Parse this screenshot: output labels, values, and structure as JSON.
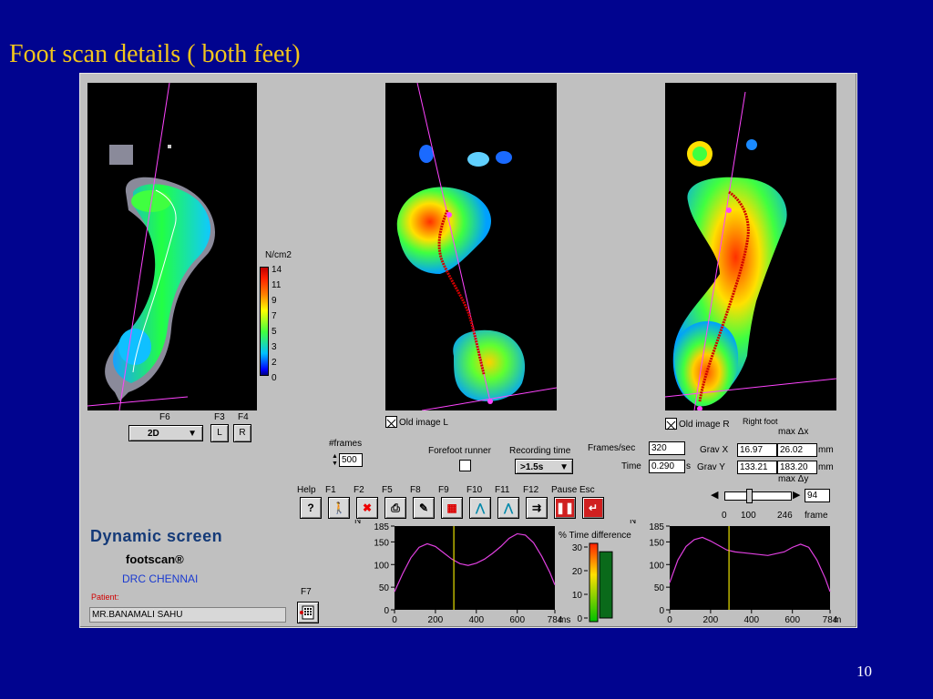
{
  "slide": {
    "title": "Foot scan details ( both feet)",
    "page_number": "10"
  },
  "colorbar": {
    "unit": "N/cm2",
    "ticks": [
      "14",
      "11",
      "9",
      "7",
      "5",
      "3",
      "2",
      "0"
    ]
  },
  "left_controls": {
    "f6_label": "F6",
    "f3_label": "F3",
    "f4_label": "F4",
    "mode_value": "2D",
    "l_button": "L",
    "r_button": "R"
  },
  "scans": {
    "old_image_l_label": "Old image L",
    "old_image_r_label": "Old image R",
    "right_foot_label": "Right foot"
  },
  "frames": {
    "label": "#frames",
    "value": "500"
  },
  "recording": {
    "forefoot_label": "Forefoot runner",
    "time_label": "Recording time",
    "time_value": ">1.5s"
  },
  "stats": {
    "fps_label": "Frames/sec",
    "fps_value": "320",
    "time_label": "Time",
    "time_value": "0.290",
    "time_unit": "s",
    "gravx_label": "Grav X",
    "gravx_value": "16.97",
    "max_dx_label": "max Δx",
    "max_dx_value": "26.02",
    "gravx_unit": "mm",
    "gravy_label": "Grav Y",
    "gravy_value": "133.21",
    "max_dy_label": "max Δy",
    "max_dy_value": "183.20",
    "gravy_unit": "mm"
  },
  "slider": {
    "value": "94",
    "ticks": [
      "0",
      "100",
      "246"
    ],
    "unit": "frame"
  },
  "toolbar": {
    "labels": [
      "Help",
      "F1",
      "F2",
      "F5",
      "F8",
      "F9",
      "F10",
      "F11",
      "F12",
      "Pause",
      "Esc"
    ],
    "f7_label": "F7"
  },
  "branding": {
    "app_name": "Dynamic screen",
    "product": "footscan®",
    "site": "DRC CHENNAI",
    "patient_label": "Patient:",
    "patient_name": "MR.BANAMALI SAHU"
  },
  "chart_data": [
    {
      "type": "line",
      "ylabel": "N",
      "xlabel": "ms",
      "ylim": [
        0,
        185
      ],
      "xlim": [
        0,
        784
      ],
      "yticks": [
        "185",
        "150",
        "100",
        "50",
        "0"
      ],
      "xticks": [
        "0",
        "200",
        "400",
        "600",
        "784"
      ],
      "cursor_x": 290,
      "series": [
        {
          "x": [
            0,
            40,
            80,
            120,
            160,
            200,
            240,
            280,
            320,
            360,
            400,
            440,
            480,
            520,
            560,
            600,
            640,
            680,
            720,
            760,
            784
          ],
          "y": [
            40,
            80,
            115,
            138,
            146,
            140,
            126,
            112,
            102,
            98,
            103,
            112,
            125,
            140,
            158,
            168,
            165,
            148,
            118,
            82,
            55
          ]
        }
      ]
    },
    {
      "type": "bar",
      "title": "% Time difference",
      "ylim": [
        0,
        30
      ],
      "yticks": [
        "30",
        "20",
        "10",
        "0"
      ],
      "series": [
        {
          "values": [
            28
          ]
        }
      ]
    },
    {
      "type": "line",
      "ylabel": "N",
      "xlabel": "m",
      "ylim": [
        0,
        185
      ],
      "xlim": [
        0,
        784
      ],
      "yticks": [
        "185",
        "150",
        "100",
        "50",
        "0"
      ],
      "xticks": [
        "0",
        "200",
        "400",
        "600",
        "784"
      ],
      "cursor_x": 290,
      "series": [
        {
          "x": [
            0,
            40,
            80,
            120,
            160,
            200,
            240,
            280,
            320,
            360,
            400,
            440,
            480,
            520,
            560,
            600,
            640,
            680,
            720,
            760,
            784
          ],
          "y": [
            60,
            110,
            140,
            155,
            160,
            152,
            142,
            132,
            128,
            126,
            124,
            122,
            120,
            124,
            128,
            138,
            145,
            138,
            110,
            70,
            40
          ]
        }
      ]
    }
  ]
}
